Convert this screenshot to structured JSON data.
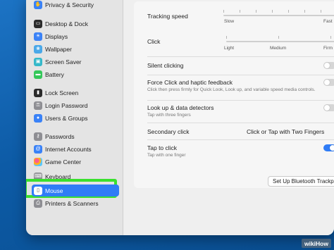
{
  "sidebar": {
    "items": [
      {
        "label": "Privacy & Security",
        "icon": "hand-icon",
        "color": "#3a82f7"
      },
      {
        "label": "Desktop & Dock",
        "icon": "dock-icon",
        "color": "#2b2b2b"
      },
      {
        "label": "Displays",
        "icon": "display-icon",
        "color": "#3a82f7"
      },
      {
        "label": "Wallpaper",
        "icon": "wallpaper-icon",
        "color": "#4aa8e8"
      },
      {
        "label": "Screen Saver",
        "icon": "screensaver-icon",
        "color": "#35b8c9"
      },
      {
        "label": "Battery",
        "icon": "battery-icon",
        "color": "#34c759"
      },
      {
        "label": "Lock Screen",
        "icon": "lock-icon",
        "color": "#2b2b2b"
      },
      {
        "label": "Login Password",
        "icon": "key-icon",
        "color": "#8e8e93"
      },
      {
        "label": "Users & Groups",
        "icon": "users-icon",
        "color": "#3a82f7"
      },
      {
        "label": "Passwords",
        "icon": "passwords-icon",
        "color": "#8e8e93"
      },
      {
        "label": "Internet Accounts",
        "icon": "at-icon",
        "color": "#3a82f7"
      },
      {
        "label": "Game Center",
        "icon": "game-center-icon",
        "color": "#e8e8e8"
      },
      {
        "label": "Keyboard",
        "icon": "keyboard-icon",
        "color": "#8e8e93"
      },
      {
        "label": "Mouse",
        "icon": "mouse-icon",
        "color": "#ffffff"
      },
      {
        "label": "Printers & Scanners",
        "icon": "printer-icon",
        "color": "#8e8e93"
      }
    ]
  },
  "settings": {
    "tracking_speed": {
      "label": "Tracking speed",
      "min_label": "Slow",
      "max_label": "Fast"
    },
    "click": {
      "label": "Click",
      "labels": [
        "Light",
        "Medium",
        "Firm"
      ]
    },
    "silent_clicking": {
      "label": "Silent clicking",
      "enabled": false
    },
    "force_click": {
      "label": "Force Click and haptic feedback",
      "description": "Click then press firmly for Quick Look, Look up, and variable speed media controls.",
      "enabled": false
    },
    "look_up": {
      "label": "Look up & data detectors",
      "description": "Tap with three fingers",
      "enabled": false
    },
    "secondary_click": {
      "label": "Secondary click",
      "value": "Click or Tap with Two Fingers"
    },
    "tap_to_click": {
      "label": "Tap to click",
      "description": "Tap with one finger",
      "enabled": true
    },
    "bluetooth_button": "Set Up Bluetooth Trackpad..."
  },
  "watermark": "wikiHow",
  "colors": {
    "accent": "#2f7cf6",
    "highlight": "#3ae02e"
  }
}
